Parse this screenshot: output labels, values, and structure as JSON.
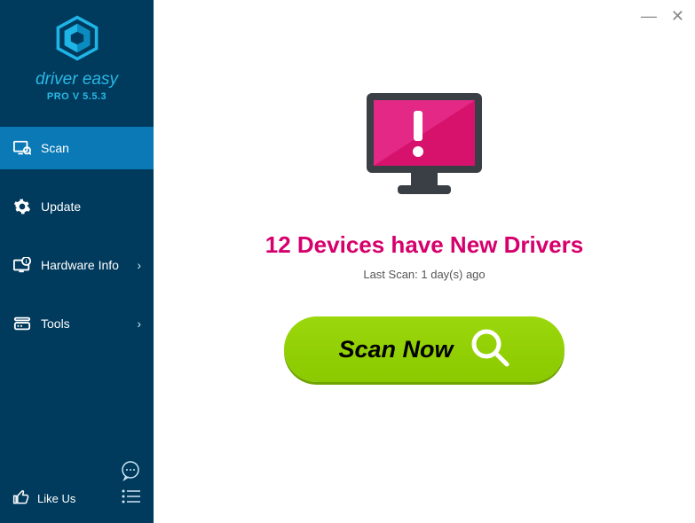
{
  "brand": "driver easy",
  "version": "PRO V 5.5.3",
  "sidebar": {
    "items": [
      {
        "label": "Scan"
      },
      {
        "label": "Update"
      },
      {
        "label": "Hardware Info"
      },
      {
        "label": "Tools"
      }
    ],
    "likeus_label": "Like Us"
  },
  "main": {
    "headline": "12 Devices have New Drivers",
    "lastscan": "Last Scan: 1 day(s) ago",
    "scan_button": "Scan Now"
  },
  "colors": {
    "sidebar_bg": "#003a5d",
    "sidebar_active": "#0a79b6",
    "accent": "#2ab9e6",
    "headline": "#d6006c",
    "scan_btn": "#8fce00",
    "monitor_screen": "#d6126c"
  }
}
